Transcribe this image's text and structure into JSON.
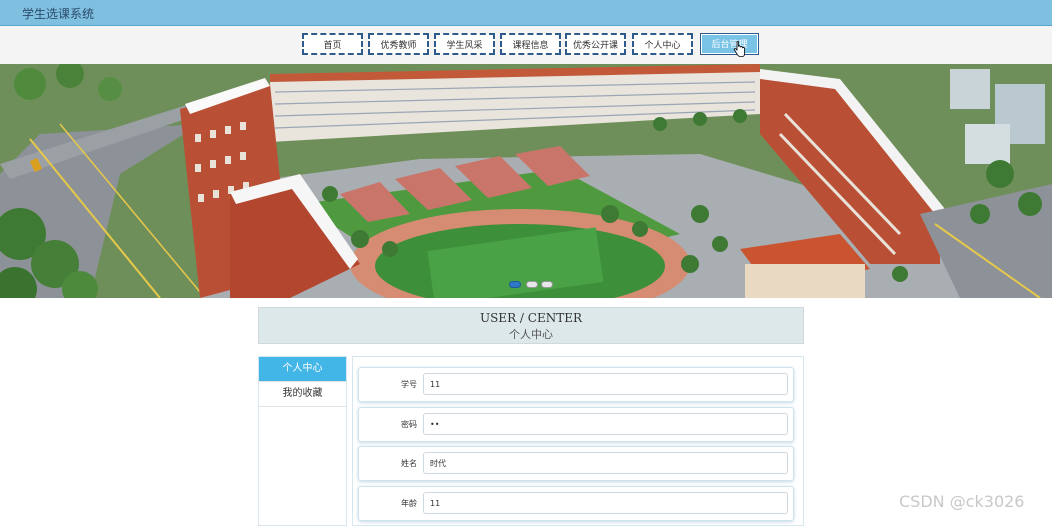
{
  "app": {
    "title": "学生选课系统"
  },
  "nav": {
    "items": [
      {
        "label": "首页"
      },
      {
        "label": "优秀教师"
      },
      {
        "label": "学生风采"
      },
      {
        "label": "课程信息"
      },
      {
        "label": "优秀公开课"
      },
      {
        "label": "个人中心"
      },
      {
        "label": "后台管理"
      }
    ],
    "active_index": 6
  },
  "banner": {
    "description_icon": "campus-illustration",
    "slide_count": 3,
    "active_slide": 1
  },
  "user_center": {
    "title_en": "USER / CENTER",
    "title_cn": "个人中心"
  },
  "side_menu": {
    "items": [
      {
        "label": "个人中心"
      },
      {
        "label": "我的收藏"
      }
    ],
    "active_index": 0
  },
  "form": {
    "fields": [
      {
        "label": "学号",
        "value": "11"
      },
      {
        "label": "密码",
        "value": "••"
      },
      {
        "label": "姓名",
        "value": "时代"
      },
      {
        "label": "年龄",
        "value": "11"
      }
    ]
  },
  "watermark": "CSDN @ck3026",
  "colors": {
    "topbar": "#7fbfe0",
    "nav_border": "#2e5a8e",
    "nav_active": "#79c3e6",
    "side_active": "#43b6e8"
  }
}
